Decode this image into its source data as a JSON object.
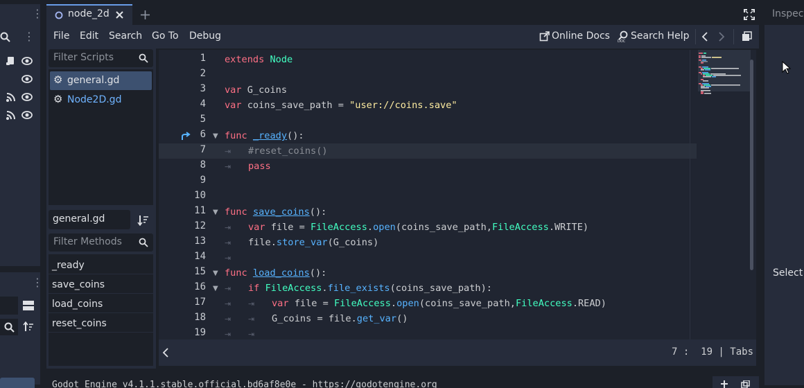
{
  "tabs": [
    {
      "label": "node_2d"
    }
  ],
  "menu": [
    "File",
    "Edit",
    "Search",
    "Go To",
    "Debug"
  ],
  "toolbar": {
    "online_docs": "Online Docs",
    "search_help": "Search Help"
  },
  "scripts": {
    "filter_placeholder": "Filter Scripts",
    "items": [
      {
        "label": "general.gd"
      },
      {
        "label": "Node2D.gd"
      }
    ]
  },
  "methods": {
    "current_script": "general.gd",
    "filter_placeholder": "Filter Methods",
    "items": [
      "_ready",
      "save_coins",
      "load_coins",
      "reset_coins"
    ]
  },
  "code": {
    "line_numbers": [
      "1",
      "2",
      "3",
      "4",
      "5",
      "6",
      "7",
      "8",
      "9",
      "10",
      "11",
      "12",
      "13",
      "14",
      "15",
      "16",
      "17",
      "18",
      "19"
    ],
    "l1a": "extends",
    "l1b": "Node",
    "l3a": "var",
    "l3b": "G_coins",
    "l4a": "var",
    "l4b": "coins_save_path = ",
    "l4c": "\"user://coins.save\"",
    "l6a": "func",
    "l6b": "_ready",
    "l7": "#reset_coins()",
    "l8": "pass",
    "l11a": "func",
    "l11b": "save_coins",
    "l12a": "var",
    "l12b": "file = ",
    "l12c": "FileAccess",
    "l12d": ".",
    "l12e": "open",
    "l12f": "(coins_save_path,",
    "l12g": "FileAccess",
    "l12h": ".WRITE)",
    "l13a": "file.",
    "l13b": "store_var",
    "l13c": "(G_coins)",
    "l15a": "func",
    "l15b": "load_coins",
    "l16a": "if",
    "l16b": "FileAccess",
    "l16c": ".",
    "l16d": "file_exists",
    "l16e": "(coins_save_path):",
    "l17a": "var",
    "l17b": "file = ",
    "l17c": "FileAccess",
    "l17d": ".",
    "l17e": "open",
    "l17f": "(coins_save_path,",
    "l17g": "FileAccess",
    "l17h": ".READ)",
    "l18a": "G_coins = file.",
    "l18b": "get_var",
    "l18c": "()"
  },
  "status": {
    "position": "7 :  19 | Tabs"
  },
  "inspector": {
    "tab": "Inspect",
    "hint": "Select a"
  },
  "output": {
    "text": "Godot Engine v4.1.1.stable.official.bd6af8e0e - https://godotengine.org"
  }
}
